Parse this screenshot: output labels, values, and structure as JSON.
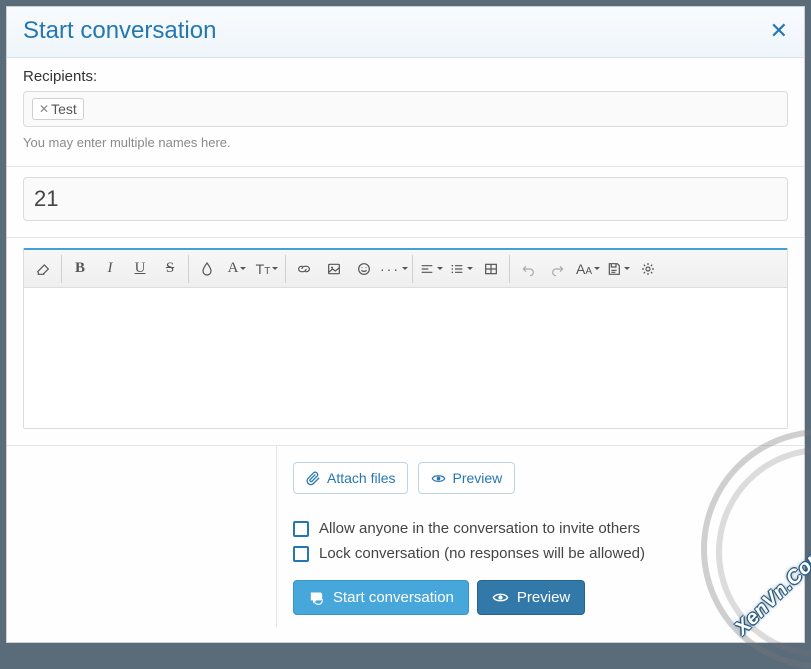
{
  "header": {
    "title": "Start conversation"
  },
  "recipients": {
    "label": "Recipients:",
    "tokens": [
      "Test"
    ],
    "hint": "You may enter multiple names here."
  },
  "titleField": {
    "value": "21"
  },
  "attachments": {
    "attach": "Attach files",
    "preview": "Preview"
  },
  "options": {
    "allow": "Allow anyone in the conversation to invite others",
    "lock": "Lock conversation (no responses will be allowed)"
  },
  "actions": {
    "start": "Start conversation",
    "preview": "Preview"
  },
  "watermark": "XenVn.Com"
}
